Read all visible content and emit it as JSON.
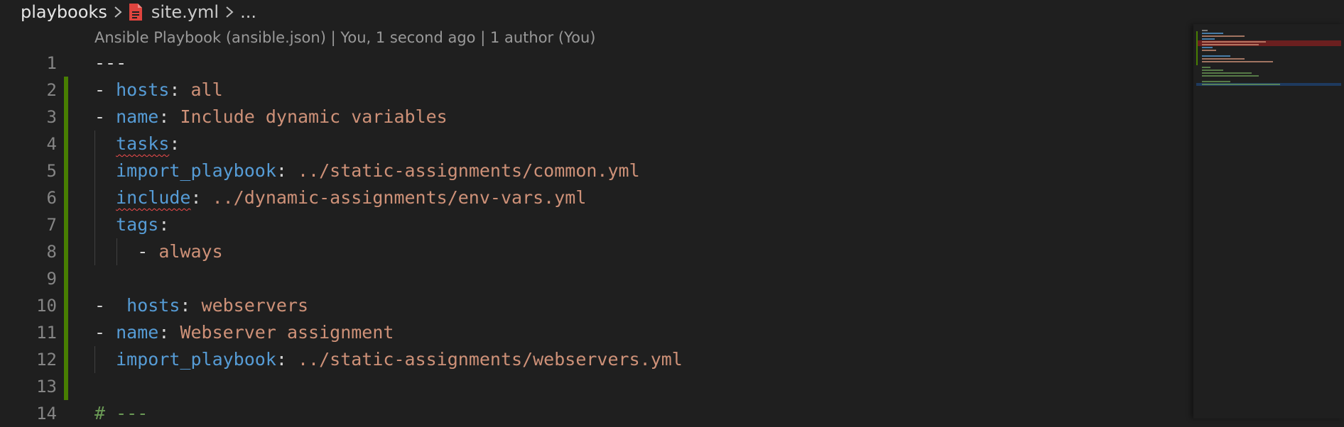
{
  "breadcrumb": {
    "root": "playbooks",
    "separator": ">",
    "file": "site.yml",
    "more": "..."
  },
  "codelens": {
    "text": "Ansible Playbook (ansible.json) | You, 1 second ago | 1 author (You)"
  },
  "lines": [
    {
      "n": "1",
      "tokens": [
        {
          "t": "---",
          "c": "p"
        }
      ]
    },
    {
      "n": "2",
      "tokens": [
        {
          "t": "- ",
          "c": "p"
        },
        {
          "t": "hosts",
          "c": "k"
        },
        {
          "t": ": ",
          "c": "p"
        },
        {
          "t": "all",
          "c": "s"
        }
      ]
    },
    {
      "n": "3",
      "tokens": [
        {
          "t": "- ",
          "c": "p"
        },
        {
          "t": "name",
          "c": "k"
        },
        {
          "t": ": ",
          "c": "p"
        },
        {
          "t": "Include dynamic variables",
          "c": "s"
        }
      ]
    },
    {
      "n": "4",
      "tokens": [
        {
          "t": "  ",
          "c": "p"
        },
        {
          "t": "tasks",
          "c": "k",
          "err": true
        },
        {
          "t": ":",
          "c": "p"
        }
      ]
    },
    {
      "n": "5",
      "tokens": [
        {
          "t": "  ",
          "c": "p"
        },
        {
          "t": "import_playbook",
          "c": "k"
        },
        {
          "t": ": ",
          "c": "p"
        },
        {
          "t": "../static-assignments/common.yml",
          "c": "s"
        }
      ]
    },
    {
      "n": "6",
      "tokens": [
        {
          "t": "  ",
          "c": "p"
        },
        {
          "t": "include",
          "c": "k",
          "err": true
        },
        {
          "t": ": ",
          "c": "p"
        },
        {
          "t": "../dynamic-assignments/env-vars.yml",
          "c": "s"
        }
      ]
    },
    {
      "n": "7",
      "tokens": [
        {
          "t": "  ",
          "c": "p"
        },
        {
          "t": "tags",
          "c": "k"
        },
        {
          "t": ":",
          "c": "p"
        }
      ]
    },
    {
      "n": "8",
      "tokens": [
        {
          "t": "    - ",
          "c": "p"
        },
        {
          "t": "always",
          "c": "s"
        }
      ]
    },
    {
      "n": "9",
      "tokens": []
    },
    {
      "n": "10",
      "tokens": [
        {
          "t": "-  ",
          "c": "p"
        },
        {
          "t": "hosts",
          "c": "k"
        },
        {
          "t": ": ",
          "c": "p"
        },
        {
          "t": "webservers",
          "c": "s"
        }
      ]
    },
    {
      "n": "11",
      "tokens": [
        {
          "t": "- ",
          "c": "p"
        },
        {
          "t": "name",
          "c": "k"
        },
        {
          "t": ": ",
          "c": "p"
        },
        {
          "t": "Webserver assignment",
          "c": "s"
        }
      ]
    },
    {
      "n": "12",
      "tokens": [
        {
          "t": "  ",
          "c": "p"
        },
        {
          "t": "import_playbook",
          "c": "k"
        },
        {
          "t": ": ",
          "c": "p"
        },
        {
          "t": "../static-assignments/webservers.yml",
          "c": "s"
        }
      ]
    },
    {
      "n": "13",
      "tokens": []
    },
    {
      "n": "14",
      "tokens": [
        {
          "t": "# ---",
          "c": "c"
        }
      ]
    }
  ],
  "colors": {
    "background": "#1f1f1f",
    "keyword": "#569cd6",
    "string": "#ce9178",
    "comment": "#6a9955",
    "gutter_added": "#487e02",
    "error_squiggle": "#f14c4c",
    "file_icon": "#e0443e"
  },
  "icons": {
    "file": "yaml-file-icon",
    "separator": "chevron-right-icon"
  }
}
